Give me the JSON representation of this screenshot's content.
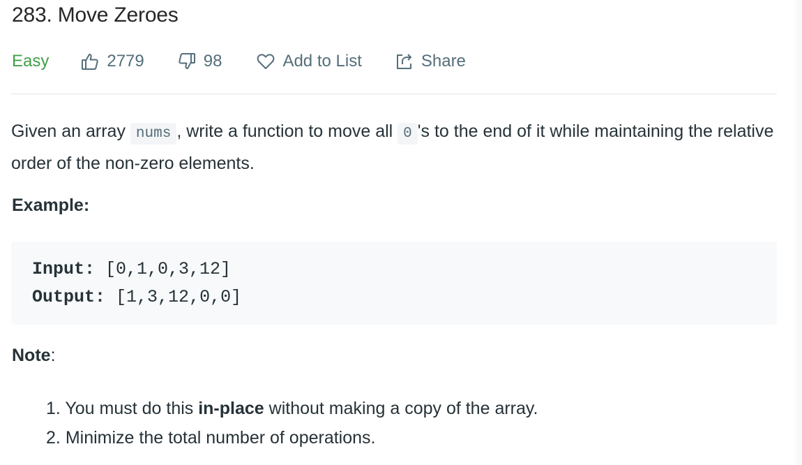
{
  "problem": {
    "title": "283. Move Zeroes",
    "difficulty": "Easy",
    "likes": "2779",
    "dislikes": "98",
    "add_to_list_label": "Add to List",
    "share_label": "Share"
  },
  "description": {
    "part1": "Given an array ",
    "code1": "nums",
    "part2": ", write a function to move all ",
    "code2": "0",
    "part3": "'s to the end of it while maintaining the relative order of the non-zero elements."
  },
  "example": {
    "heading": "Example:",
    "input_label": "Input:",
    "input_value": "[0,1,0,3,12]",
    "output_label": "Output:",
    "output_value": "[1,3,12,0,0]"
  },
  "note": {
    "heading": "Note",
    "colon": ":",
    "items": [
      {
        "number": "1.",
        "pre": "You must do this ",
        "bold": "in-place",
        "post": " without making a copy of the array."
      },
      {
        "number": "2.",
        "pre": "Minimize the total number of operations.",
        "bold": "",
        "post": ""
      }
    ]
  },
  "colors": {
    "easy": "#43a047",
    "meta_text": "#546e7a",
    "code_bg": "#f7f9fa"
  },
  "icons": [
    "thumbs-up-icon",
    "thumbs-down-icon",
    "heart-icon",
    "share-icon"
  ]
}
